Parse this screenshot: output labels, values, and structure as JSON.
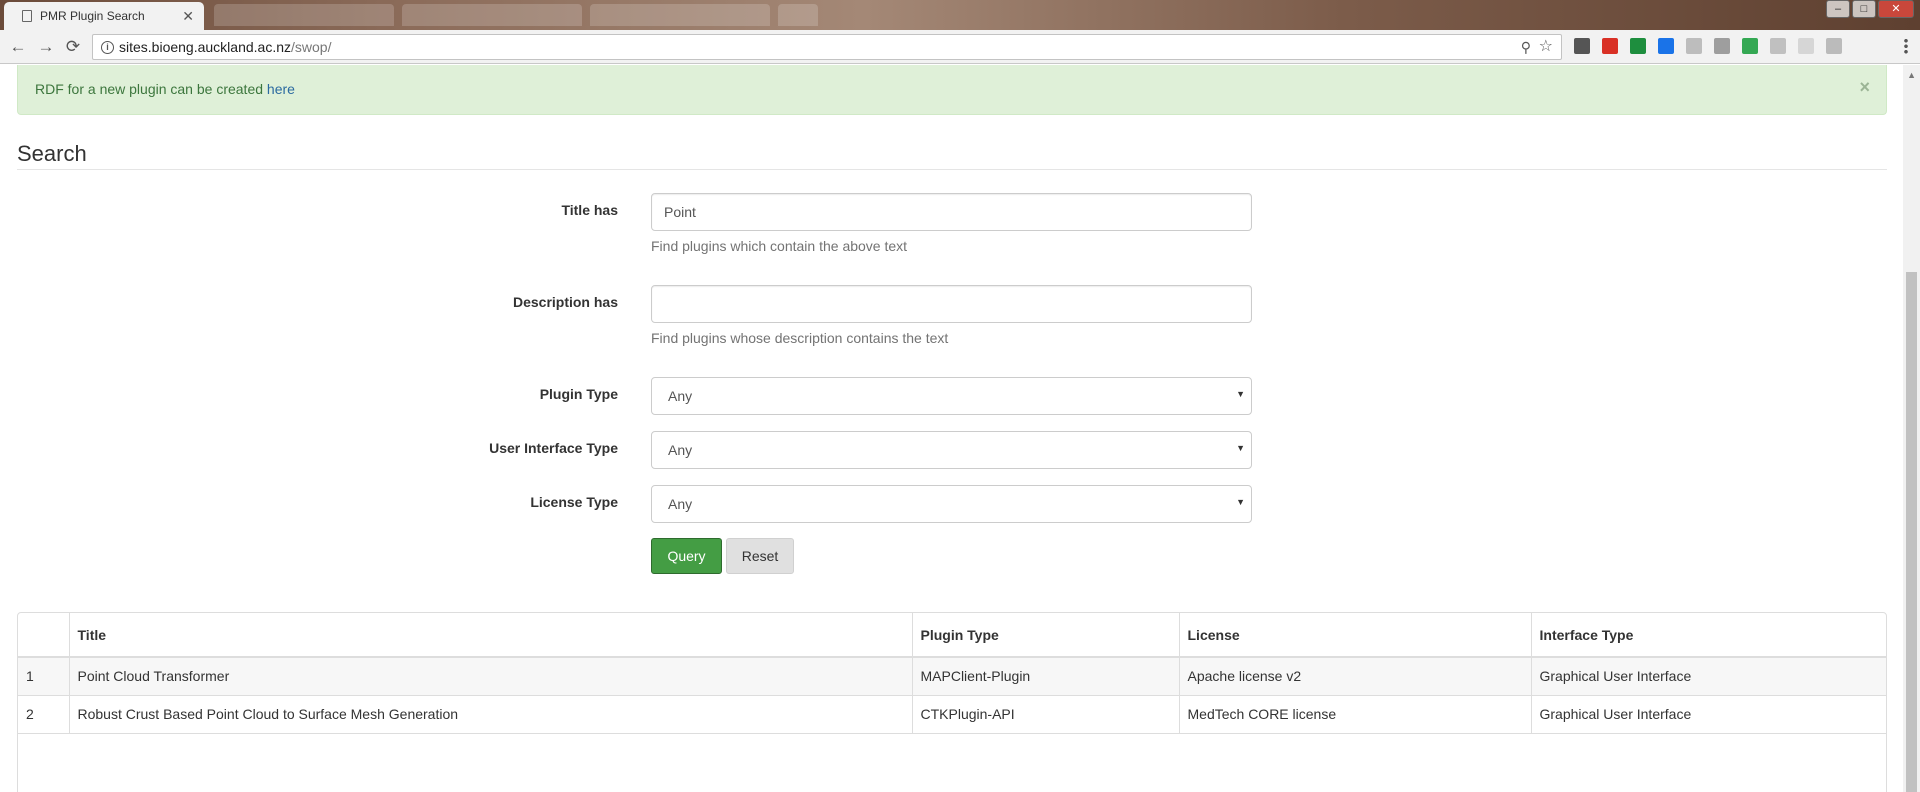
{
  "browser": {
    "active_tab_title": "PMR Plugin Search",
    "tab_close": "✕",
    "url_host": "sites.bioeng.auckland.ac.nz",
    "url_path": "/swop/",
    "win_min": "–",
    "win_max": "□",
    "win_close": "✕"
  },
  "alert": {
    "text": "RDF for a new plugin can be created ",
    "link_text": "here",
    "close": "×"
  },
  "search": {
    "heading": "Search",
    "title_label": "Title has",
    "title_value": "Point",
    "title_help": "Find plugins which contain the above text",
    "description_label": "Description has",
    "description_value": "",
    "description_help": "Find plugins whose description contains the text",
    "plugin_type_label": "Plugin Type",
    "plugin_type_value": "Any",
    "ui_type_label": "User Interface Type",
    "ui_type_value": "Any",
    "license_label": "License Type",
    "license_value": "Any",
    "query_button": "Query",
    "reset_button": "Reset"
  },
  "results": {
    "headers": [
      "",
      "Title",
      "Plugin Type",
      "License",
      "Interface Type"
    ],
    "rows": [
      {
        "index": "1",
        "title": "Point Cloud Transformer",
        "plugin_type": "MAPClient-Plugin",
        "license": "Apache license v2",
        "interface": "Graphical User Interface"
      },
      {
        "index": "2",
        "title": "Robust Crust Based Point Cloud to Surface Mesh Generation",
        "plugin_type": "CTKPlugin-API",
        "license": "MedTech CORE license",
        "interface": "Graphical User Interface"
      }
    ]
  },
  "colors": {
    "alert_bg": "#dff0d8",
    "alert_text": "#3c763d",
    "query_button": "#449d44",
    "link": "#2b6aa0"
  }
}
